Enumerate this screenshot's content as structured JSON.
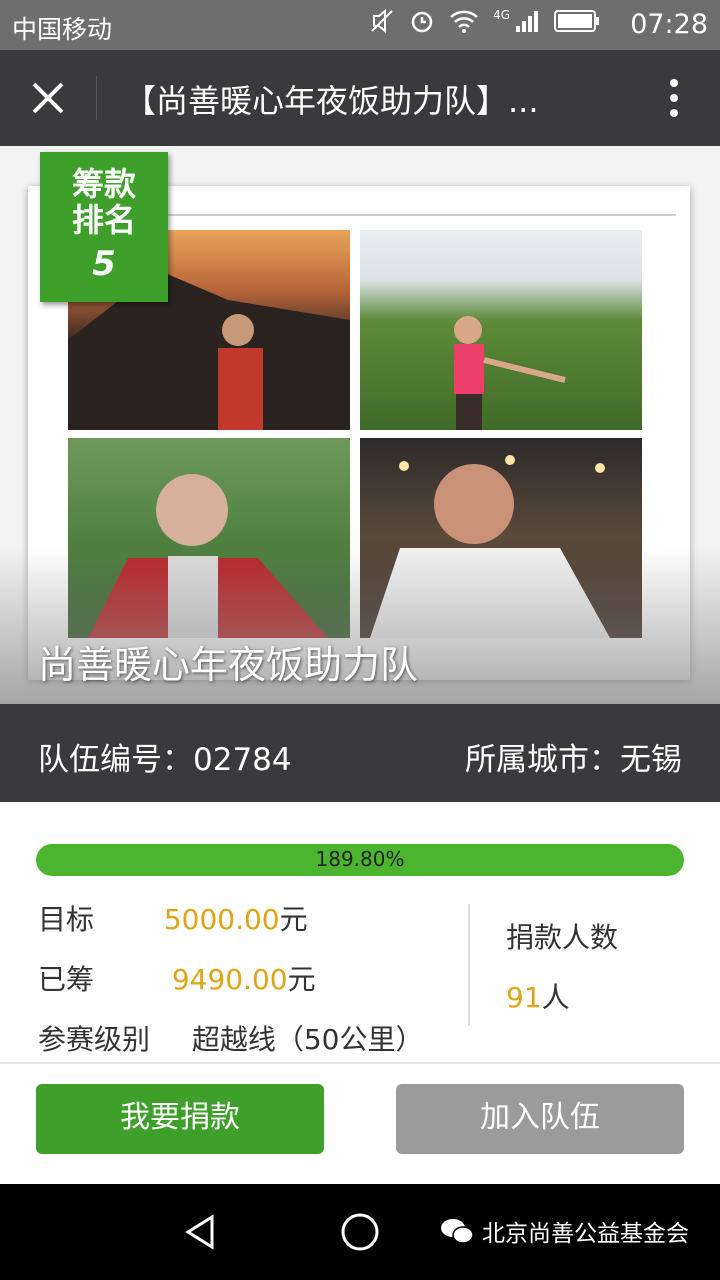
{
  "status_bar": {
    "carrier": "中国移动",
    "network": "4G",
    "time": "07:28"
  },
  "title_bar": {
    "title": "【尚善暖心年夜饭助力队】..."
  },
  "hero": {
    "rank_label_1": "筹款",
    "rank_label_2": "排名",
    "rank_number": "5",
    "team_name": "尚善暖心年夜饭助力队"
  },
  "info_bar": {
    "team_id": "队伍编号：02784",
    "city": "所属城市：无锡"
  },
  "progress": {
    "text": "189.80%",
    "value_percent": 189.8
  },
  "stats": {
    "target_label": "目标",
    "target_value": "5000.00",
    "target_unit": "元",
    "raised_label": "已筹",
    "raised_value": "9490.00",
    "raised_unit": "元",
    "level_label": "参赛级别",
    "level_value": "超越线（50公里）",
    "donors_label": "捐款人数",
    "donors_value": "91",
    "donors_unit": "人"
  },
  "actions": {
    "donate_label": "我要捐款",
    "join_label": "加入队伍"
  },
  "watermark": {
    "text": "北京尚善公益基金会"
  },
  "colors": {
    "green": "#3ea02b",
    "dark": "#3a3a3c",
    "amber": "#e0a418",
    "gray_button": "#9b9b9b"
  }
}
